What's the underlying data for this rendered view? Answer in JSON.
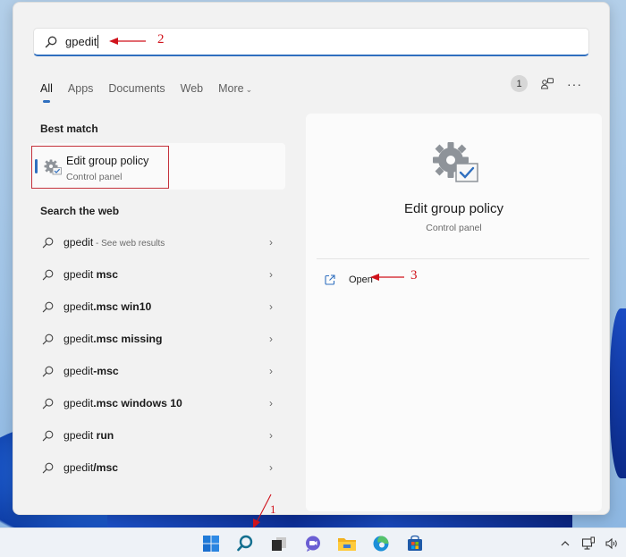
{
  "search": {
    "query": "gpedit",
    "icon": "search-icon"
  },
  "filters": {
    "tabs": [
      {
        "label": "All",
        "active": true
      },
      {
        "label": "Apps",
        "active": false
      },
      {
        "label": "Documents",
        "active": false
      },
      {
        "label": "Web",
        "active": false
      },
      {
        "label": "More",
        "active": false
      }
    ],
    "more_chevron": "⌄",
    "badge_count": "1",
    "ellipsis": "···"
  },
  "best_match": {
    "section_title": "Best match",
    "title": "Edit group policy",
    "subtitle": "Control panel",
    "icon": "group-policy-gear-icon"
  },
  "web": {
    "section_title": "Search the web",
    "items": [
      {
        "plain": "gpedit",
        "bold": "",
        "note": " - See web results"
      },
      {
        "plain": "gpedit ",
        "bold": "msc",
        "note": ""
      },
      {
        "plain": "gpedit",
        "bold": ".msc win10",
        "note": ""
      },
      {
        "plain": "gpedit",
        "bold": ".msc missing",
        "note": ""
      },
      {
        "plain": "gpedit",
        "bold": "-msc",
        "note": ""
      },
      {
        "plain": "gpedit",
        "bold": ".msc windows 10",
        "note": ""
      },
      {
        "plain": "gpedit ",
        "bold": "run",
        "note": ""
      },
      {
        "plain": "gpedit",
        "bold": "/msc",
        "note": ""
      }
    ],
    "chevron": "›"
  },
  "detail": {
    "title": "Edit group policy",
    "subtitle": "Control panel",
    "open_label": "Open"
  },
  "annotations": {
    "step1": "1",
    "step2": "2",
    "step3": "3",
    "color": "#d0121b"
  },
  "colors": {
    "accent": "#2f6fbf",
    "highlight_box": "#c4313b"
  },
  "taskbar": {
    "apps": [
      "start",
      "search",
      "task-view",
      "chat",
      "file-explorer",
      "edge",
      "store"
    ],
    "tray": [
      "show-hidden-icons",
      "network",
      "volume"
    ]
  }
}
